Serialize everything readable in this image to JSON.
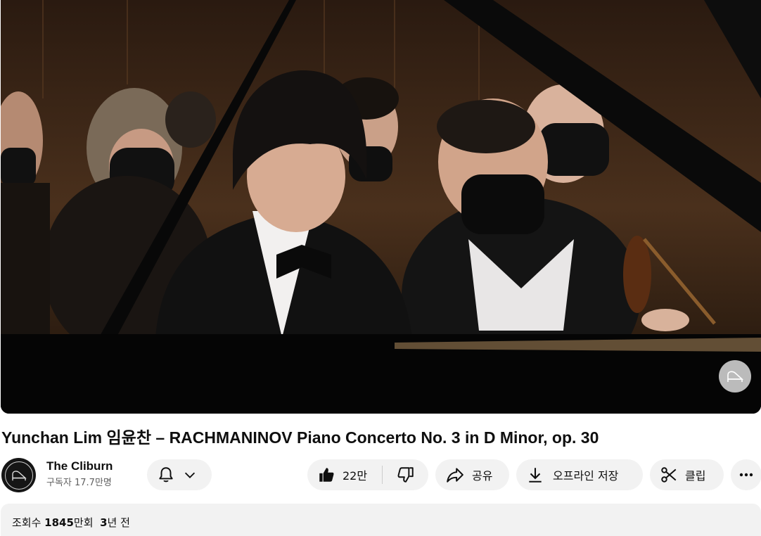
{
  "video": {
    "title": "Yunchan Lim 임윤찬 – RACHMANINOV Piano Concerto No. 3 in D Minor, op. 30",
    "watermark_icon": "piano-icon"
  },
  "channel": {
    "name": "The Cliburn",
    "subscribers": "구독자 17.7만명",
    "avatar_icon": "piano-icon"
  },
  "actions": {
    "bell_icon": "bell-icon",
    "like_count": "22만",
    "share_label": "공유",
    "offline_label": "오프라인 저장",
    "clip_label": "클립"
  },
  "description": {
    "views_prefix": "조회수 ",
    "views_count": "1845",
    "views_unit": "만회",
    "age_number": "3",
    "age_unit": "년 전"
  }
}
